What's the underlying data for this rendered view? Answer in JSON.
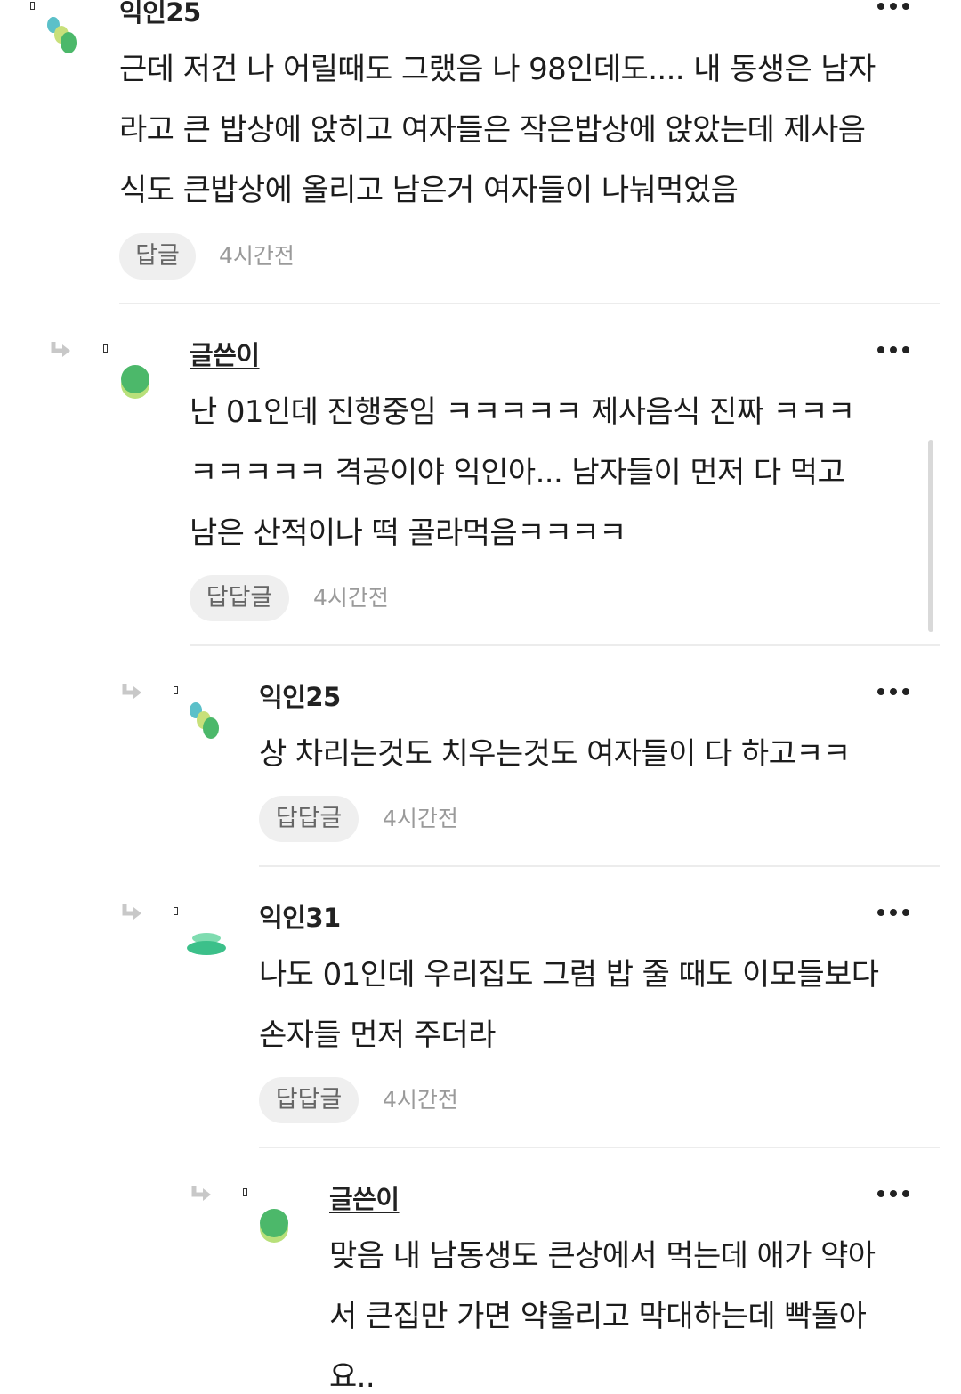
{
  "comments": [
    {
      "author": "익인25",
      "lines": [
        "근데 저건 나 어릴때도 그랬음 나 98인데도.... 내 동생은 남자",
        "라고 큰 밥상에 앉히고 여자들은 작은밥상에 앉았는데 제사음",
        "식도 큰밥상에 올리고 남은거 여자들이 나눠먹었음"
      ],
      "reply_label": "답글",
      "time": "4시간전",
      "avatar_colors": [
        "#5bc0c9",
        "#c8e07a",
        "#4cb86a"
      ]
    },
    {
      "author": "글쓴이",
      "lines": [
        "난 01인데 진행중임 ㅋㅋㅋㅋㅋ 제사음식 진짜 ㅋㅋㅋ",
        "ㅋㅋㅋㅋㅋ 격공이야 익인아... 남자들이 먼저 다 먹고",
        "남은 산적이나 떡 골라먹음ㅋㅋㅋㅋ"
      ],
      "reply_label": "답답글",
      "time": "4시간전",
      "avatar_colors": [
        "#b8e07a",
        "#4cb86a"
      ]
    },
    {
      "author": "익인25",
      "lines": [
        "상 차리는것도 치우는것도 여자들이 다 하고ㅋㅋ"
      ],
      "reply_label": "답답글",
      "time": "4시간전",
      "avatar_colors": [
        "#5bc0c9",
        "#c8e07a",
        "#4cb86a"
      ]
    },
    {
      "author": "익인31",
      "lines": [
        "나도 01인데 우리집도 그럼 밥 줄 때도 이모들보다",
        "손자들 먼저 주더라"
      ],
      "reply_label": "답답글",
      "time": "4시간전",
      "avatar_colors": [
        "#7fdcb0",
        "#3cc08a"
      ]
    },
    {
      "author": "글쓴이",
      "lines": [
        "맞음 내 남동생도 큰상에서 먹는데 애가 약아",
        "서 큰집만 가면 약올리고 막대하는데 빡돌아",
        "요.."
      ],
      "avatar_colors": [
        "#b8e07a",
        "#4cb86a"
      ]
    }
  ]
}
